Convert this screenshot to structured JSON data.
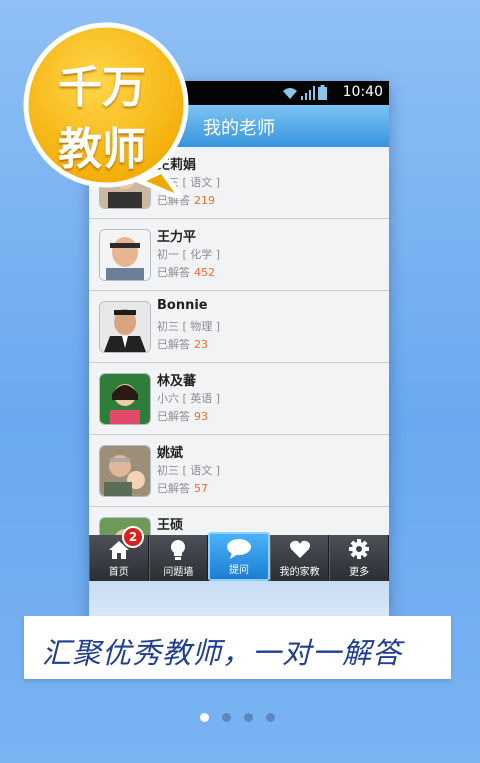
{
  "badge_bubble": {
    "line1": "千万",
    "line2": "教师"
  },
  "status_bar": {
    "time": "10:40"
  },
  "header": {
    "title": "我的老师"
  },
  "teachers": [
    {
      "name": "王莉娟",
      "grade": "初三",
      "subject": "语文",
      "answered_label": "已解答",
      "count": "219"
    },
    {
      "name": "王力平",
      "grade": "初一",
      "subject": "化学",
      "answered_label": "已解答",
      "count": "452"
    },
    {
      "name": "Bonnie",
      "grade": "初三",
      "subject": "物理",
      "answered_label": "已解答",
      "count": "23"
    },
    {
      "name": "林及蕃",
      "grade": "小六",
      "subject": "英语",
      "answered_label": "已解答",
      "count": "93"
    },
    {
      "name": "姚斌",
      "grade": "初三",
      "subject": "语文",
      "answered_label": "已解答",
      "count": "57"
    },
    {
      "name": "王硕",
      "grade": "",
      "subject": "",
      "answered_label": "",
      "count": ""
    }
  ],
  "tabs": [
    {
      "label": "首页",
      "icon": "home-icon",
      "badge": "2"
    },
    {
      "label": "问题墙",
      "icon": "lightbulb-icon"
    },
    {
      "label": "提问",
      "icon": "chat-bubble-icon"
    },
    {
      "label": "我的家教",
      "icon": "heart-icon"
    },
    {
      "label": "更多",
      "icon": "gear-icon"
    }
  ],
  "caption": {
    "text": "汇聚优秀教师，一对一解答"
  },
  "pager": {
    "pages": 4,
    "current": 1
  },
  "colors": {
    "accent": "#3794dc",
    "count": "#ef6a2a",
    "bubble": "#f6b400",
    "background": "#7cb3f0"
  }
}
